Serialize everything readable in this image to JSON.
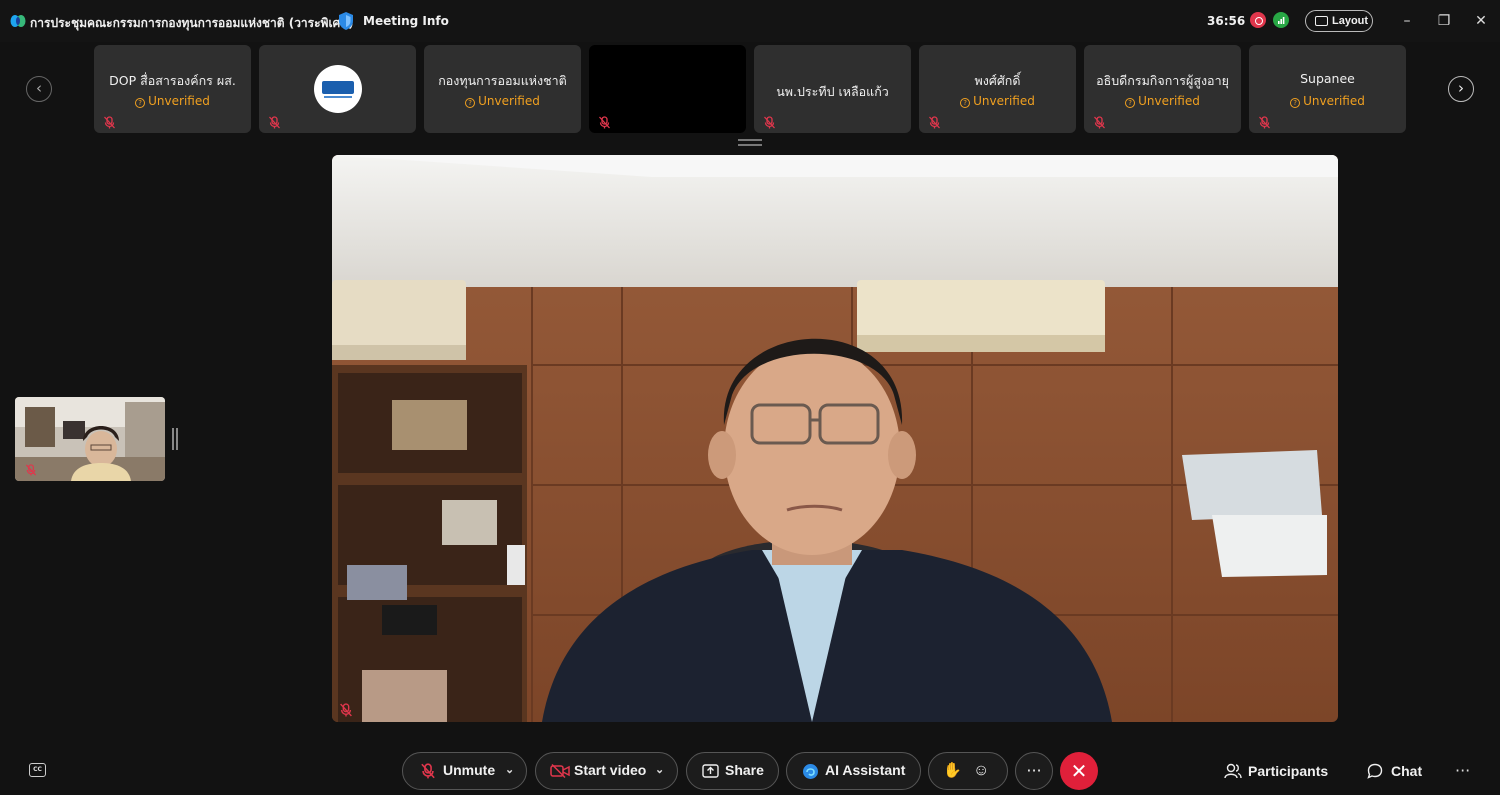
{
  "titlebar": {
    "meeting_title": "การประชุมคณะกรรมการกองทุนการออมแห่งชาติ (วาระพิเศษ)",
    "meeting_info": "Meeting Info",
    "timer": "36:56",
    "layout_label": "Layout",
    "minimize": "–",
    "restore": "❐",
    "close": "✕"
  },
  "filmstrip": {
    "prev": "‹",
    "next": "›",
    "tiles": [
      {
        "name": "DOP สื่อสารองค์กร ผส.",
        "status": "Unverified"
      },
      {
        "name": "",
        "status": ""
      },
      {
        "name": "กองทุนการออมแห่งชาติ",
        "status": "Unverified"
      },
      {
        "name": "",
        "status": ""
      },
      {
        "name": "นพ.ประทีป เหลือแก้ว",
        "status": ""
      },
      {
        "name": "พงศ์ศักดิ์",
        "status": "Unverified"
      },
      {
        "name": "อธิบดีกรมกิจการผู้สูงอายุ",
        "status": "Unverified"
      },
      {
        "name": "Supanee",
        "status": "Unverified"
      }
    ]
  },
  "toolbar": {
    "cc": "CC",
    "unmute": "Unmute",
    "start_video": "Start video",
    "share": "Share",
    "ai_assistant": "AI Assistant",
    "more": "···",
    "end": "✕",
    "participants": "Participants",
    "chat": "Chat",
    "overflow": "···"
  },
  "colors": {
    "background": "#121212",
    "tile": "#2f2f2f",
    "unverified": "#f0a020",
    "end_call": "#e0203a",
    "mute_icon": "#e0364c",
    "recording": "#e0364c",
    "network_ok": "#28a745"
  },
  "icons": {
    "app_logo": "webex-logo-icon",
    "security": "shield-icon",
    "recording": "recording-icon",
    "network": "network-signal-icon",
    "layout": "layout-icon",
    "muted": "mic-muted-icon",
    "unverified": "unverified-icon",
    "video_off": "video-off-icon",
    "share": "share-icon",
    "ai": "ai-assistant-icon",
    "raise_hand": "raise-hand-icon",
    "reactions": "reactions-icon",
    "participants": "participants-icon",
    "chat": "chat-icon"
  }
}
